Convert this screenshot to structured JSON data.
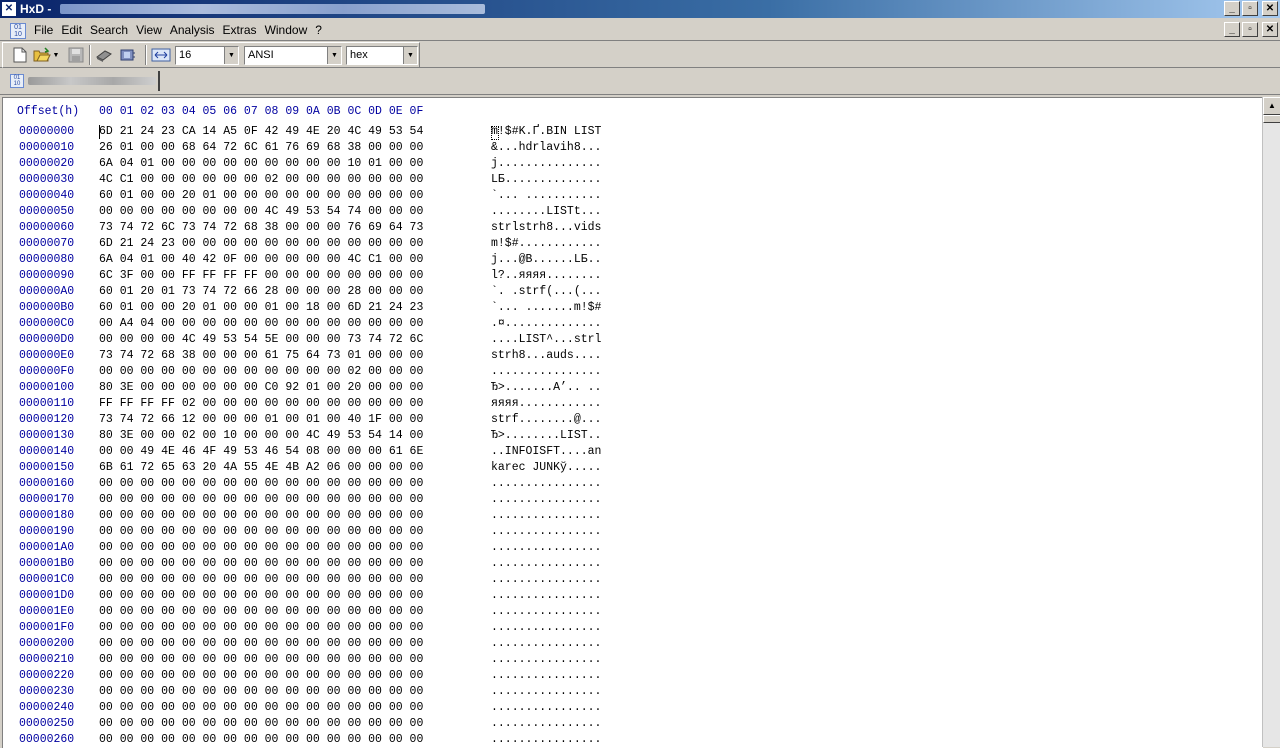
{
  "window": {
    "title": "HxD - ",
    "buttons": {
      "minimize": "_",
      "maximize": "▫",
      "close": "✕"
    }
  },
  "menu": {
    "items": [
      "File",
      "Edit",
      "Search",
      "View",
      "Analysis",
      "Extras",
      "Window",
      "?"
    ]
  },
  "toolbar": {
    "bytes_per_row": "16",
    "charset": "ANSI",
    "offset_base": "hex"
  },
  "editor": {
    "offset_header": "Offset(h)",
    "column_header": "00 01 02 03 04 05 06 07 08 09 0A 0B 0C 0D 0E 0F",
    "rows": [
      {
        "offset": "00000000",
        "hex": "6D 21 24 23 CA 14 A5 0F 42 49 4E 20 4C 49 53 54",
        "text": "m!$#K.Ґ.BIN LIST"
      },
      {
        "offset": "00000010",
        "hex": "26 01 00 00 68 64 72 6C 61 76 69 68 38 00 00 00",
        "text": "&...hdrlavih8..."
      },
      {
        "offset": "00000020",
        "hex": "6A 04 01 00 00 00 00 00 00 00 00 00 10 01 00 00",
        "text": "j..............."
      },
      {
        "offset": "00000030",
        "hex": "4C C1 00 00 00 00 00 00 02 00 00 00 00 00 00 00",
        "text": "LБ.............."
      },
      {
        "offset": "00000040",
        "hex": "60 01 00 00 20 01 00 00 00 00 00 00 00 00 00 00",
        "text": "`... ..........."
      },
      {
        "offset": "00000050",
        "hex": "00 00 00 00 00 00 00 00 4C 49 53 54 74 00 00 00",
        "text": "........LISTt..."
      },
      {
        "offset": "00000060",
        "hex": "73 74 72 6C 73 74 72 68 38 00 00 00 76 69 64 73",
        "text": "strlstrh8...vids"
      },
      {
        "offset": "00000070",
        "hex": "6D 21 24 23 00 00 00 00 00 00 00 00 00 00 00 00",
        "text": "m!$#............"
      },
      {
        "offset": "00000080",
        "hex": "6A 04 01 00 40 42 0F 00 00 00 00 00 4C C1 00 00",
        "text": "j...@B......LБ.."
      },
      {
        "offset": "00000090",
        "hex": "6C 3F 00 00 FF FF FF FF 00 00 00 00 00 00 00 00",
        "text": "l?..яяяя........"
      },
      {
        "offset": "000000A0",
        "hex": "60 01 20 01 73 74 72 66 28 00 00 00 28 00 00 00",
        "text": "`. .strf(...(..."
      },
      {
        "offset": "000000B0",
        "hex": "60 01 00 00 20 01 00 00 01 00 18 00 6D 21 24 23",
        "text": "`... .......m!$#"
      },
      {
        "offset": "000000C0",
        "hex": "00 A4 04 00 00 00 00 00 00 00 00 00 00 00 00 00",
        "text": ".¤.............."
      },
      {
        "offset": "000000D0",
        "hex": "00 00 00 00 4C 49 53 54 5E 00 00 00 73 74 72 6C",
        "text": "....LIST^...strl"
      },
      {
        "offset": "000000E0",
        "hex": "73 74 72 68 38 00 00 00 61 75 64 73 01 00 00 00",
        "text": "strh8...auds...."
      },
      {
        "offset": "000000F0",
        "hex": "00 00 00 00 00 00 00 00 00 00 00 00 02 00 00 00",
        "text": "................"
      },
      {
        "offset": "00000100",
        "hex": "80 3E 00 00 00 00 00 00 C0 92 01 00 20 00 00 00",
        "text": "Ђ>.......А’.. .."
      },
      {
        "offset": "00000110",
        "hex": "FF FF FF FF 02 00 00 00 00 00 00 00 00 00 00 00",
        "text": "яяяя............"
      },
      {
        "offset": "00000120",
        "hex": "73 74 72 66 12 00 00 00 01 00 01 00 40 1F 00 00",
        "text": "strf........@..."
      },
      {
        "offset": "00000130",
        "hex": "80 3E 00 00 02 00 10 00 00 00 4C 49 53 54 14 00",
        "text": "Ђ>........LIST.."
      },
      {
        "offset": "00000140",
        "hex": "00 00 49 4E 46 4F 49 53 46 54 08 00 00 00 61 6E",
        "text": "..INFOISFT....an"
      },
      {
        "offset": "00000150",
        "hex": "6B 61 72 65 63 20 4A 55 4E 4B A2 06 00 00 00 00",
        "text": "karec JUNKў....."
      },
      {
        "offset": "00000160",
        "hex": "00 00 00 00 00 00 00 00 00 00 00 00 00 00 00 00",
        "text": "................"
      },
      {
        "offset": "00000170",
        "hex": "00 00 00 00 00 00 00 00 00 00 00 00 00 00 00 00",
        "text": "................"
      },
      {
        "offset": "00000180",
        "hex": "00 00 00 00 00 00 00 00 00 00 00 00 00 00 00 00",
        "text": "................"
      },
      {
        "offset": "00000190",
        "hex": "00 00 00 00 00 00 00 00 00 00 00 00 00 00 00 00",
        "text": "................"
      },
      {
        "offset": "000001A0",
        "hex": "00 00 00 00 00 00 00 00 00 00 00 00 00 00 00 00",
        "text": "................"
      },
      {
        "offset": "000001B0",
        "hex": "00 00 00 00 00 00 00 00 00 00 00 00 00 00 00 00",
        "text": "................"
      },
      {
        "offset": "000001C0",
        "hex": "00 00 00 00 00 00 00 00 00 00 00 00 00 00 00 00",
        "text": "................"
      },
      {
        "offset": "000001D0",
        "hex": "00 00 00 00 00 00 00 00 00 00 00 00 00 00 00 00",
        "text": "................"
      },
      {
        "offset": "000001E0",
        "hex": "00 00 00 00 00 00 00 00 00 00 00 00 00 00 00 00",
        "text": "................"
      },
      {
        "offset": "000001F0",
        "hex": "00 00 00 00 00 00 00 00 00 00 00 00 00 00 00 00",
        "text": "................"
      },
      {
        "offset": "00000200",
        "hex": "00 00 00 00 00 00 00 00 00 00 00 00 00 00 00 00",
        "text": "................"
      },
      {
        "offset": "00000210",
        "hex": "00 00 00 00 00 00 00 00 00 00 00 00 00 00 00 00",
        "text": "................"
      },
      {
        "offset": "00000220",
        "hex": "00 00 00 00 00 00 00 00 00 00 00 00 00 00 00 00",
        "text": "................"
      },
      {
        "offset": "00000230",
        "hex": "00 00 00 00 00 00 00 00 00 00 00 00 00 00 00 00",
        "text": "................"
      },
      {
        "offset": "00000240",
        "hex": "00 00 00 00 00 00 00 00 00 00 00 00 00 00 00 00",
        "text": "................"
      },
      {
        "offset": "00000250",
        "hex": "00 00 00 00 00 00 00 00 00 00 00 00 00 00 00 00",
        "text": "................"
      },
      {
        "offset": "00000260",
        "hex": "00 00 00 00 00 00 00 00 00 00 00 00 00 00 00 00",
        "text": "................"
      }
    ]
  }
}
